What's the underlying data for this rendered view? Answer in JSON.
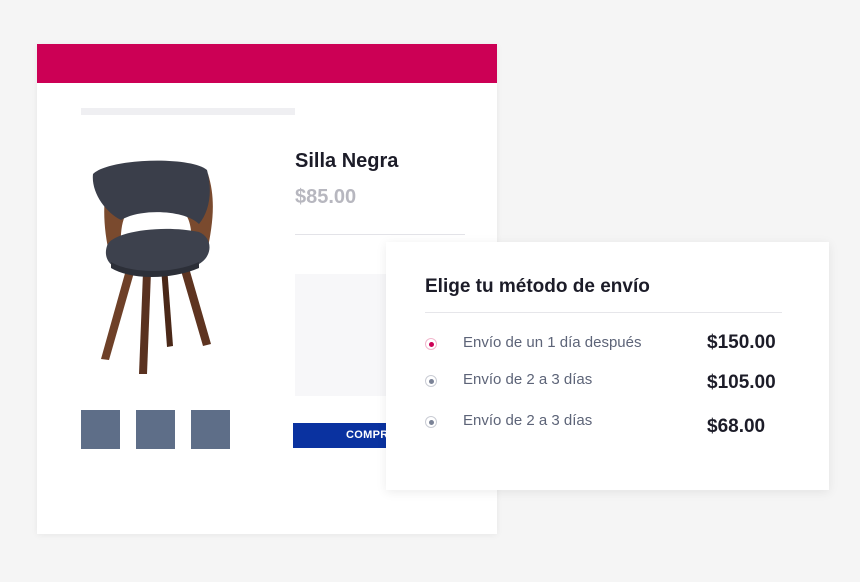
{
  "product": {
    "title": "Silla Negra",
    "price": "$85.00",
    "buy_button_label": "COMPR",
    "image": "black-chair-image",
    "thumbnail_count": 3
  },
  "shipping": {
    "title": "Elige tu método de envío",
    "options": [
      {
        "label": "Envío de un 1 día después",
        "price": "$150.00",
        "selected": true
      },
      {
        "label": "Envío de 2 a 3 días",
        "price": "$105.00",
        "selected": false
      },
      {
        "label": "Envío de 2 a 3 días",
        "price": "$68.00",
        "selected": false
      }
    ]
  },
  "colors": {
    "accent": "#cc0055",
    "button": "#0a32a0",
    "thumbnail": "#5e6e88"
  }
}
